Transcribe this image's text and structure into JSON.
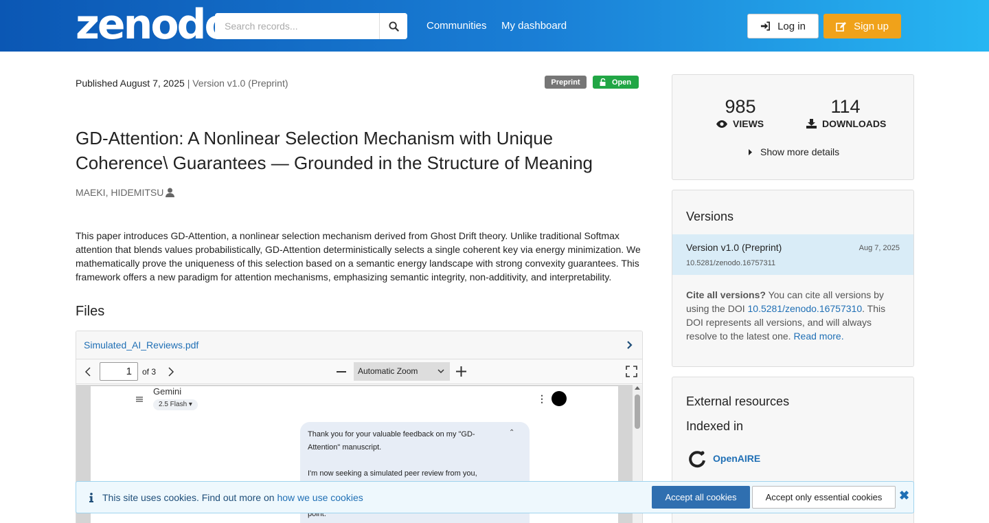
{
  "header": {
    "logo": "zenodo",
    "search_placeholder": "Search records...",
    "nav": [
      "Communities",
      "My dashboard"
    ],
    "login_label": "Log in",
    "signup_label": "Sign up"
  },
  "record": {
    "published": "Published August 7, 2025",
    "version": "| Version v1.0 (Preprint)",
    "badge_type": "Preprint",
    "badge_access": "Open",
    "title": "GD-Attention: A Nonlinear Selection Mechanism with Unique Coherence\\ Guarantees — Grounded in the Structure of Meaning",
    "author": "MAEKI, HIDEMITSU",
    "abstract": "This paper introduces GD-Attention, a nonlinear selection mechanism derived from Ghost Drift theory. Unlike traditional Softmax attention that blends values probabilistically, GD-Attention deterministically selects a single coherent key via energy minimization. We mathematically prove the uniqueness of this selection based on a semantic energy landscape with strong convexity guarantees. This framework offers a new paradigm for attention mechanisms, emphasizing semantic integrity, non-additivity, and interpretability."
  },
  "files": {
    "heading": "Files",
    "filename": "Simulated_AI_Reviews.pdf",
    "page": "1",
    "of_pages": "of 3",
    "zoom": "Automatic Zoom",
    "preview": {
      "app": "Gemini",
      "model": "2.5 Flash",
      "line1": "Thank you for your valuable feedback on my \"GD-",
      "line2": "Attention\" manuscript.",
      "line3": "I'm now seeking a simulated peer review from you,",
      "line4": "point."
    }
  },
  "stats": {
    "views": "985",
    "views_label": "VIEWS",
    "downloads": "114",
    "downloads_label": "DOWNLOADS",
    "more_details": "Show more details"
  },
  "versions": {
    "heading": "Versions",
    "item_title": "Version v1.0 (Preprint)",
    "item_date": "Aug 7, 2025",
    "item_doi": "10.5281/zenodo.16757311",
    "cite_bold": "Cite all versions?",
    "cite_text1": " You can cite all versions by using the DOI ",
    "cite_doi": "10.5281/zenodo.16757310",
    "cite_text2": ". This DOI represents all versions, and will always resolve to the latest one. ",
    "read_more": "Read more."
  },
  "external": {
    "heading": "External resources",
    "indexed": "Indexed in",
    "openaire": "OpenAIRE"
  },
  "cookie": {
    "text": "This site uses cookies. Find out more on ",
    "link": "how we use cookies",
    "accept_all": "Accept all cookies",
    "accept_essential": "Accept only essential cookies"
  },
  "colors": {
    "brand": "#1a7fd6",
    "signup": "#f0a21a",
    "open": "#21a645",
    "link": "#1f6fb5"
  }
}
